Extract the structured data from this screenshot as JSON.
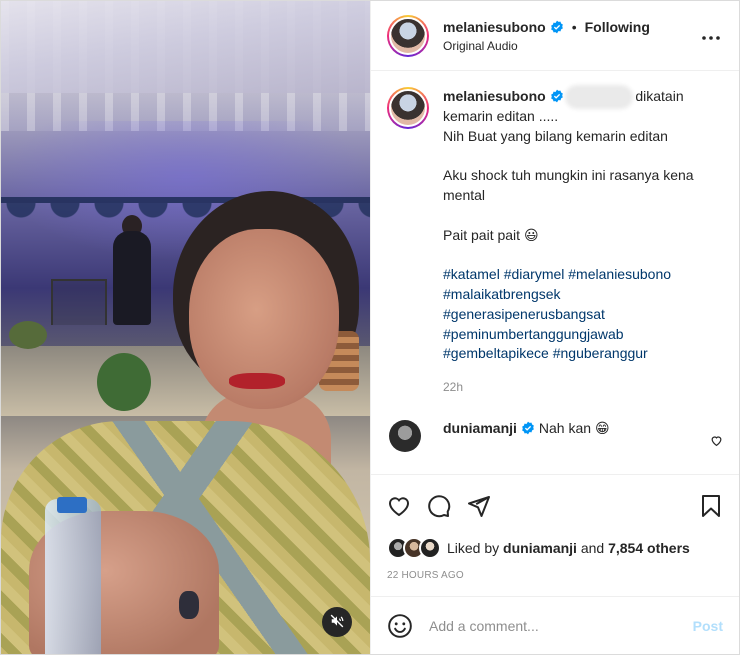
{
  "post": {
    "username": "melaniesubono",
    "follow_status": "Following",
    "separator": "•",
    "audio": "Original Audio",
    "verified_icon": "verified-badge-icon",
    "accent_color": "#0095f6"
  },
  "caption": {
    "username": "melaniesubono",
    "line1": "dikatain",
    "line2": "kemarin editan .....",
    "line3": "Nih Buat yang bilang kemarin editan",
    "line4": "Aku shock tuh mungkin ini rasanya kena",
    "line5": "mental",
    "line6": "Pait pait pait 😃",
    "hashtags": [
      "#katamel #diarymel #melaniesubono",
      "#malaikatbrengsek",
      "#generasipenerusbangsat",
      "#peminumbertanggungjawab",
      "#gembeltapikece #nguberanggur"
    ],
    "time": "22h"
  },
  "comment": {
    "username": "duniamanji",
    "text": "Nah kan 😁"
  },
  "likes": {
    "prefix": "Liked by",
    "user": "duniamanji",
    "middle": "and",
    "count": "7,854 others"
  },
  "post_time": "22 HOURS AGO",
  "add_comment": {
    "placeholder": "Add a comment...",
    "post_label": "Post"
  }
}
